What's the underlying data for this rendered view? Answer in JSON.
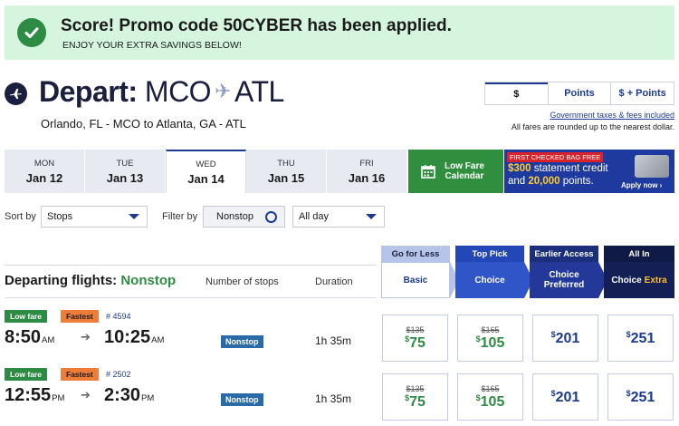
{
  "promo": {
    "title": "Score! Promo code 50CYBER has been applied.",
    "subtitle": "ENJOY YOUR EXTRA SAVINGS BELOW!",
    "check_icon": "check-circle-icon"
  },
  "header": {
    "depart_label": "Depart:",
    "origin": "MCO",
    "destination": "ATL",
    "route_text": "Orlando, FL - MCO to Atlanta, GA - ATL",
    "plane_icon": "plane-icon"
  },
  "currency_toggle": {
    "options": [
      "$",
      "Points",
      "$ + Points"
    ],
    "selected": "$"
  },
  "fees_link": "Government taxes & fees included",
  "fees_note": "All fares are rounded up to the nearest dollar.",
  "dates": [
    {
      "dow": "MON",
      "date": "Jan 12"
    },
    {
      "dow": "TUE",
      "date": "Jan 13"
    },
    {
      "dow": "WED",
      "date": "Jan 14",
      "active": true
    },
    {
      "dow": "THU",
      "date": "Jan 15"
    },
    {
      "dow": "FRI",
      "date": "Jan 16"
    }
  ],
  "low_fare_calendar": {
    "line1": "Low Fare",
    "line2": "Calendar"
  },
  "ad": {
    "badge": "FIRST CHECKED BAG FREE",
    "line1_amount": "$300",
    "line1_rest": " statement credit",
    "line2_pre": "and ",
    "line2_amount": "20,000",
    "line2_rest": " points.",
    "apply": "Apply now ›"
  },
  "filters": {
    "sort_label": "Sort by",
    "sort_value": "Stops",
    "filter_label": "Filter by",
    "nonstop_value": "Nonstop",
    "time_value": "All day"
  },
  "fare_columns": [
    {
      "top": "Go for Less",
      "bottom": "Basic"
    },
    {
      "top": "Top Pick",
      "bottom": "Choice"
    },
    {
      "top": "Earlier Access",
      "bottom1": "Choice",
      "bottom2": "Preferred"
    },
    {
      "top": "All In",
      "bottom": "Choice",
      "bottom_extra": "Extra"
    }
  ],
  "list_header": {
    "title": "Departing flights:",
    "title_highlight": "Nonstop",
    "col_stops": "Number of stops",
    "col_duration": "Duration"
  },
  "flights": [
    {
      "tag_low": "Low fare",
      "tag_fast": "Fastest",
      "flight_no": "# 4594",
      "dep_time": "8:50",
      "dep_ampm": "AM",
      "arr_time": "10:25",
      "arr_ampm": "AM",
      "stops": "Nonstop",
      "duration": "1h 35m",
      "prices": [
        {
          "old": "$135",
          "now": "75"
        },
        {
          "old": "$165",
          "now": "105"
        },
        {
          "now": "201"
        },
        {
          "now": "251"
        }
      ]
    },
    {
      "tag_low": "Low fare",
      "tag_fast": "Fastest",
      "flight_no": "# 2502",
      "dep_time": "12:55",
      "dep_ampm": "PM",
      "arr_time": "2:30",
      "arr_ampm": "PM",
      "stops": "Nonstop",
      "duration": "1h 35m",
      "prices": [
        {
          "old": "$135",
          "now": "75"
        },
        {
          "old": "$165",
          "now": "105"
        },
        {
          "now": "201"
        },
        {
          "now": "251"
        }
      ]
    }
  ],
  "colors": {
    "brand_blue": "#1c3b8f",
    "success_green": "#2e8b43",
    "promo_bg": "#d5f5de"
  }
}
